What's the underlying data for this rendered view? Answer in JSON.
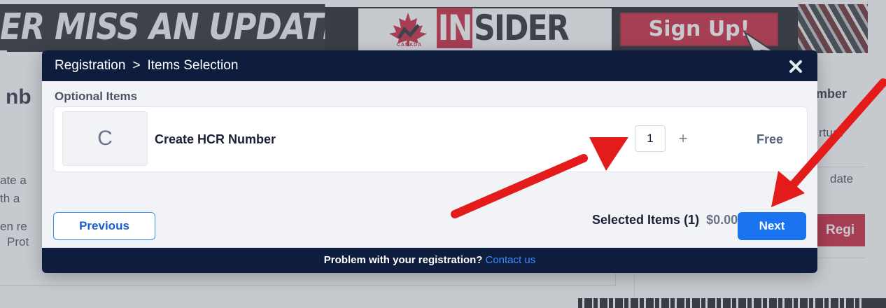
{
  "banner": {
    "slogan": "ER MISS AN UPDATE.",
    "logo_in": "IN",
    "logo_sider": "SIDER",
    "logo_canada": "CANADA",
    "signup": "Sign Up!"
  },
  "background": {
    "heading_fragment": "nb",
    "lines": [
      "ate a",
      "th a",
      "en re",
      "Prot"
    ],
    "right_heading_fragment": "mber",
    "right_lines": [
      "rtuat",
      "date"
    ],
    "right_button_fragment": "Regi"
  },
  "modal": {
    "breadcrumb": [
      "Registration",
      "Items Selection"
    ],
    "breadcrumb_separator": ">",
    "close_icon": "close-icon",
    "section_title": "Optional Items",
    "items": [
      {
        "thumb_letter": "C",
        "name": "Create HCR Number",
        "quantity": "1",
        "price": "Free"
      }
    ],
    "quantity_minus": "−",
    "quantity_plus": "+",
    "summary_label": "Selected Items (1)",
    "summary_total": "$0.00",
    "previous_label": "Previous",
    "next_label": "Next",
    "footer_text": "Problem with your registration?",
    "footer_link": "Contact us"
  },
  "annotations": {
    "arrow_color": "#e41b1b",
    "arrows": [
      "annotation-arrow-to-quantity",
      "annotation-arrow-to-next"
    ]
  },
  "colors": {
    "header_navy": "#0e1d3e",
    "primary_blue": "#1a74ef",
    "brand_red": "#c8102e"
  }
}
